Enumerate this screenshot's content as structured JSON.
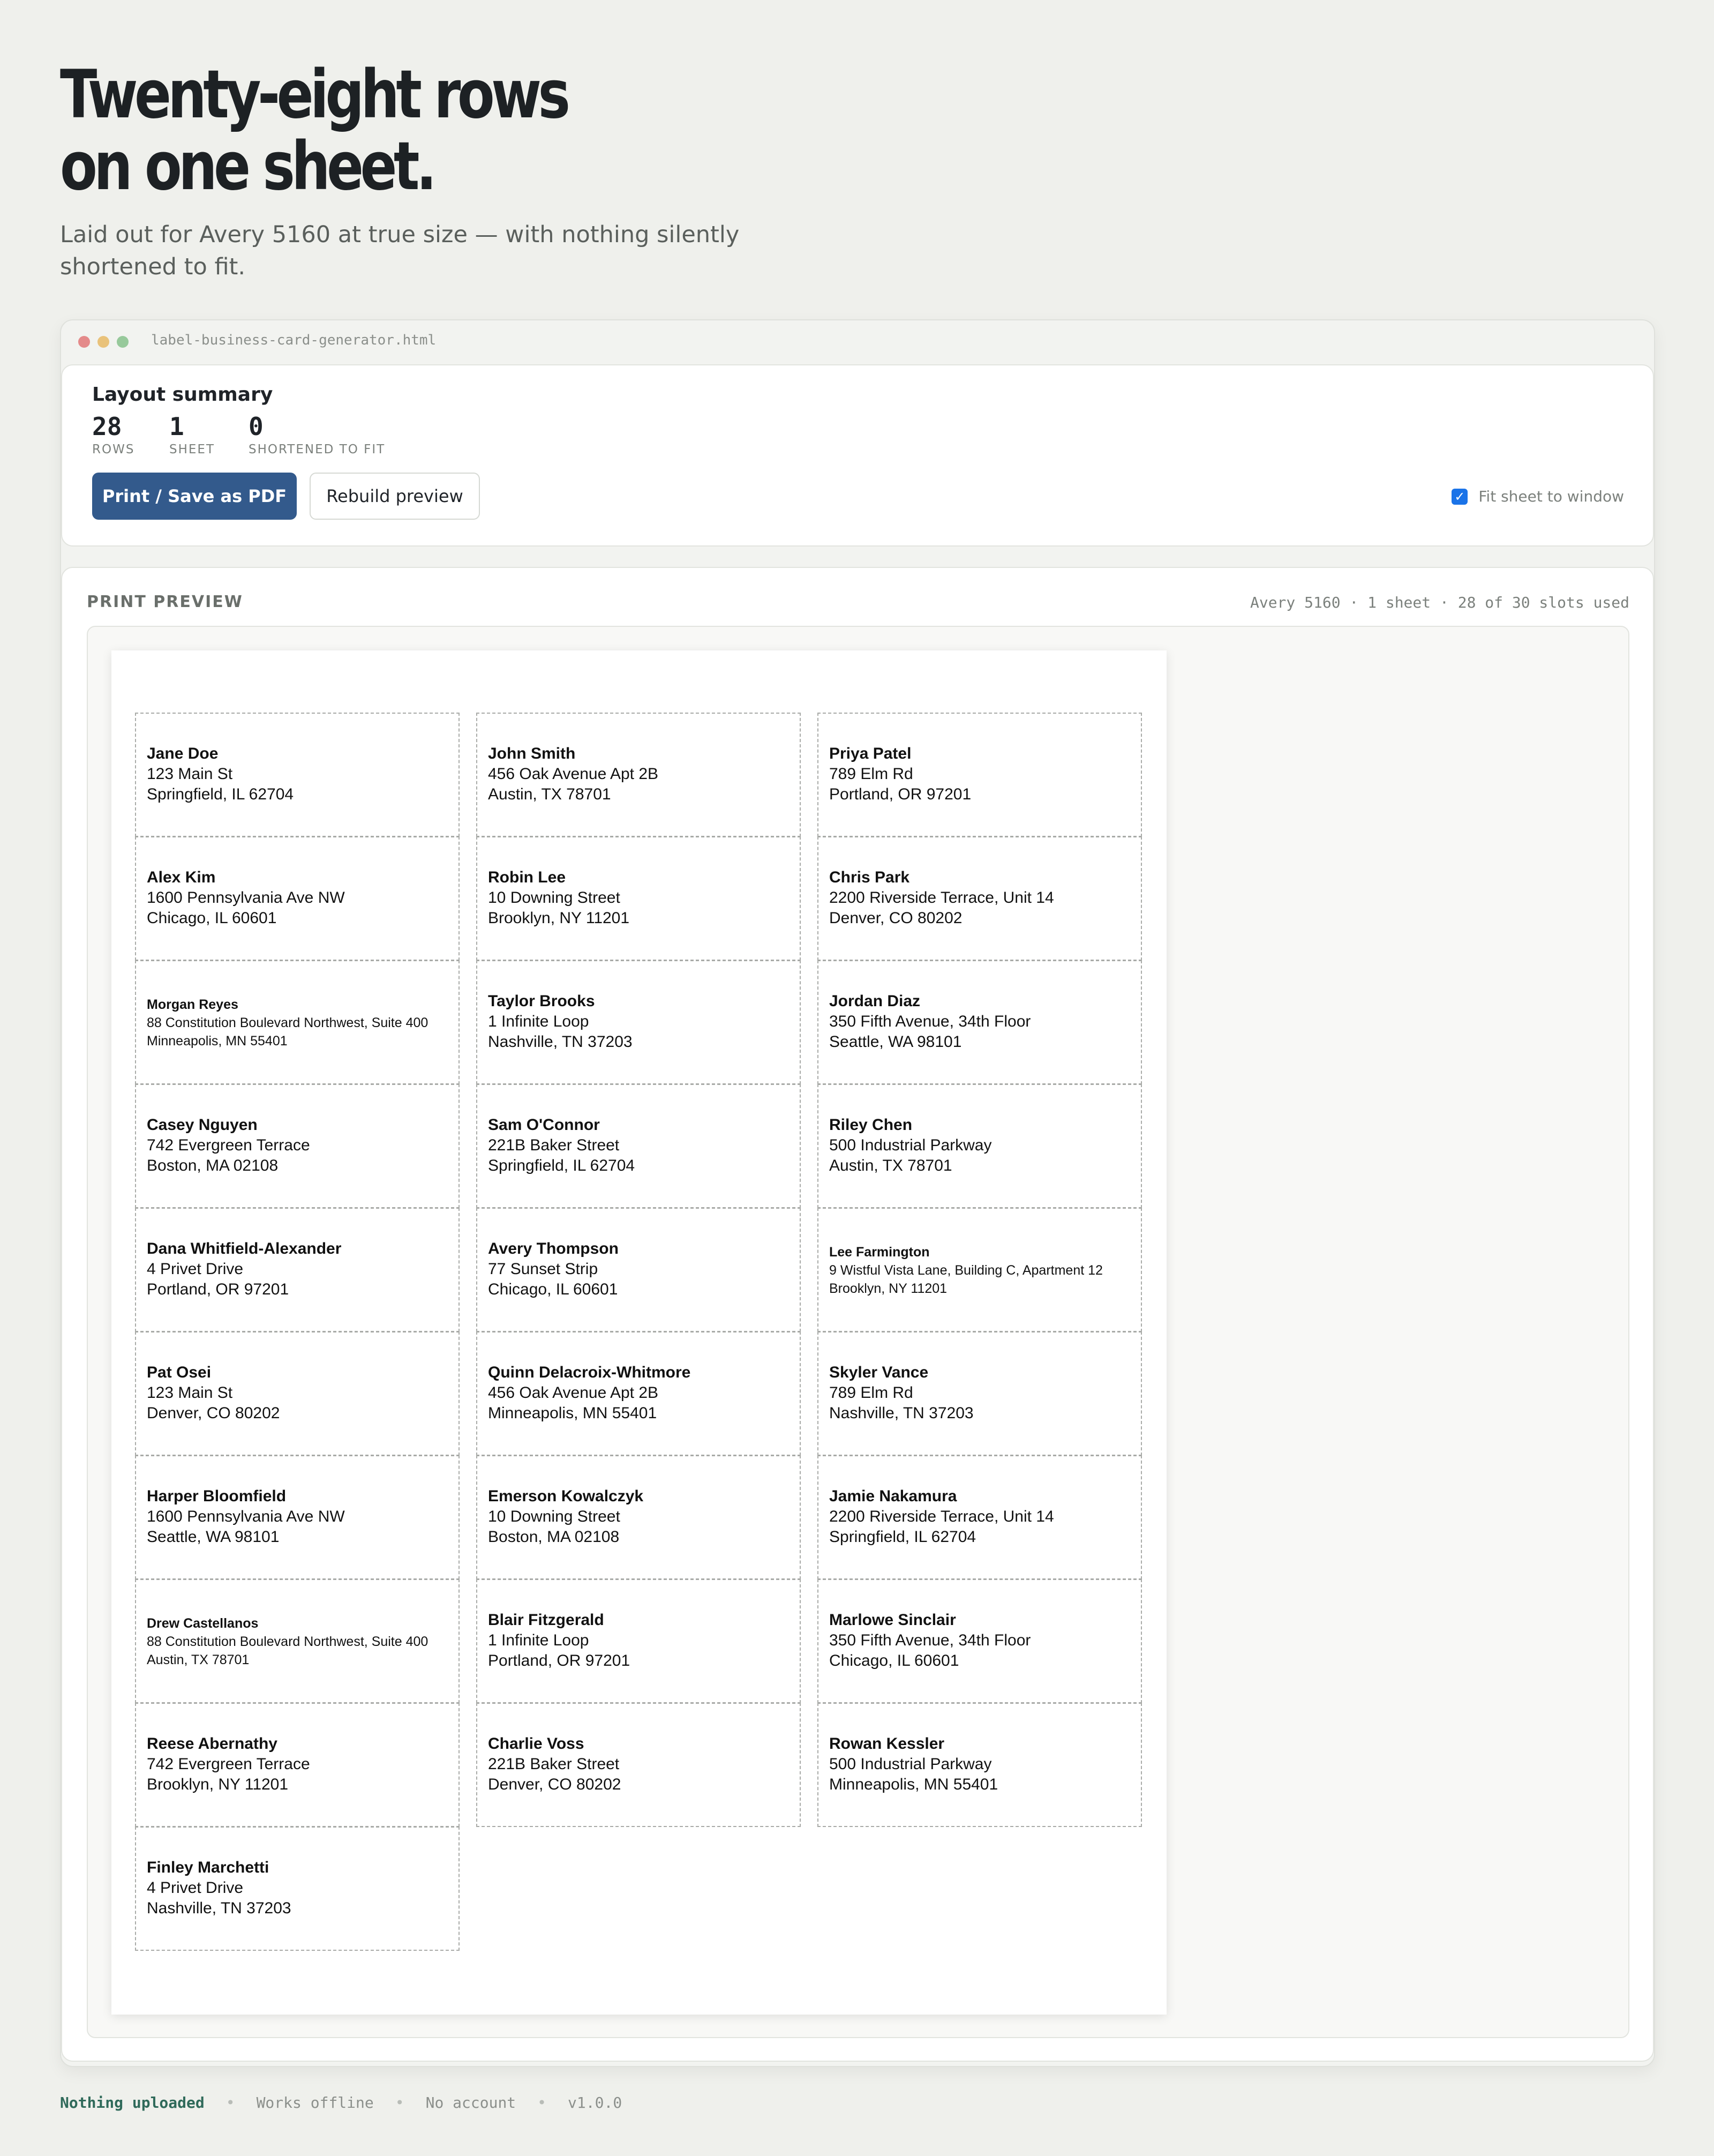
{
  "hero": {
    "title_line1": "Twenty-eight rows",
    "title_line2": "on one sheet.",
    "subtitle": "Laid out for Avery 5160 at true size — with nothing silently shortened to fit."
  },
  "window": {
    "filename": "label-business-card-generator.html"
  },
  "summary": {
    "heading": "Layout summary",
    "stats": [
      {
        "value": "28",
        "label": "ROWS"
      },
      {
        "value": "1",
        "label": "SHEET"
      },
      {
        "value": "0",
        "label": "SHORTENED TO FIT"
      }
    ],
    "print_button": "Print / Save as PDF",
    "rebuild_button": "Rebuild preview",
    "fit_label": "Fit sheet to window",
    "fit_checked": true,
    "accent_color": "#335a8c"
  },
  "preview": {
    "title": "PRINT PREVIEW",
    "info": "Avery 5160 · 1 sheet · 28 of 30 slots used",
    "labels": [
      {
        "name": "Jane Doe",
        "line1": "123 Main St",
        "line2": "Springfield, IL 62704",
        "small": false
      },
      {
        "name": "John Smith",
        "line1": "456 Oak Avenue Apt 2B",
        "line2": "Austin, TX 78701",
        "small": false
      },
      {
        "name": "Priya Patel",
        "line1": "789 Elm Rd",
        "line2": "Portland, OR 97201",
        "small": false
      },
      {
        "name": "Alex Kim",
        "line1": "1600 Pennsylvania Ave NW",
        "line2": "Chicago, IL 60601",
        "small": false
      },
      {
        "name": "Robin Lee",
        "line1": "10 Downing Street",
        "line2": "Brooklyn, NY 11201",
        "small": false
      },
      {
        "name": "Chris Park",
        "line1": "2200 Riverside Terrace, Unit 14",
        "line2": "Denver, CO 80202",
        "small": false
      },
      {
        "name": "Morgan Reyes",
        "line1": "88 Constitution Boulevard Northwest, Suite 400",
        "line2": "Minneapolis, MN 55401",
        "small": true
      },
      {
        "name": "Taylor Brooks",
        "line1": "1 Infinite Loop",
        "line2": "Nashville, TN 37203",
        "small": false
      },
      {
        "name": "Jordan Diaz",
        "line1": "350 Fifth Avenue, 34th Floor",
        "line2": "Seattle, WA 98101",
        "small": false
      },
      {
        "name": "Casey Nguyen",
        "line1": "742 Evergreen Terrace",
        "line2": "Boston, MA 02108",
        "small": false
      },
      {
        "name": "Sam O'Connor",
        "line1": "221B Baker Street",
        "line2": "Springfield, IL 62704",
        "small": false
      },
      {
        "name": "Riley Chen",
        "line1": "500 Industrial Parkway",
        "line2": "Austin, TX 78701",
        "small": false
      },
      {
        "name": "Dana Whitfield-Alexander",
        "line1": "4 Privet Drive",
        "line2": "Portland, OR 97201",
        "small": false
      },
      {
        "name": "Avery Thompson",
        "line1": "77 Sunset Strip",
        "line2": "Chicago, IL 60601",
        "small": false
      },
      {
        "name": "Lee Farmington",
        "line1": "9 Wistful Vista Lane, Building C, Apartment 12",
        "line2": "Brooklyn, NY 11201",
        "small": true
      },
      {
        "name": "Pat Osei",
        "line1": "123 Main St",
        "line2": "Denver, CO 80202",
        "small": false
      },
      {
        "name": "Quinn Delacroix-Whitmore",
        "line1": "456 Oak Avenue Apt 2B",
        "line2": "Minneapolis, MN 55401",
        "small": false
      },
      {
        "name": "Skyler Vance",
        "line1": "789 Elm Rd",
        "line2": "Nashville, TN 37203",
        "small": false
      },
      {
        "name": "Harper Bloomfield",
        "line1": "1600 Pennsylvania Ave NW",
        "line2": "Seattle, WA 98101",
        "small": false
      },
      {
        "name": "Emerson Kowalczyk",
        "line1": "10 Downing Street",
        "line2": "Boston, MA 02108",
        "small": false
      },
      {
        "name": "Jamie Nakamura",
        "line1": "2200 Riverside Terrace, Unit 14",
        "line2": "Springfield, IL 62704",
        "small": false
      },
      {
        "name": "Drew Castellanos",
        "line1": "88 Constitution Boulevard Northwest, Suite 400",
        "line2": "Austin, TX 78701",
        "small": true
      },
      {
        "name": "Blair Fitzgerald",
        "line1": "1 Infinite Loop",
        "line2": "Portland, OR 97201",
        "small": false
      },
      {
        "name": "Marlowe Sinclair",
        "line1": "350 Fifth Avenue, 34th Floor",
        "line2": "Chicago, IL 60601",
        "small": false
      },
      {
        "name": "Reese Abernathy",
        "line1": "742 Evergreen Terrace",
        "line2": "Brooklyn, NY 11201",
        "small": false
      },
      {
        "name": "Charlie Voss",
        "line1": "221B Baker Street",
        "line2": "Denver, CO 80202",
        "small": false
      },
      {
        "name": "Rowan Kessler",
        "line1": "500 Industrial Parkway",
        "line2": "Minneapolis, MN 55401",
        "small": false
      },
      {
        "name": "Finley Marchetti",
        "line1": "4 Privet Drive",
        "line2": "Nashville, TN 37203",
        "small": false
      }
    ]
  },
  "footer": {
    "items": [
      "Nothing uploaded",
      "Works offline",
      "No account",
      "v1.0.0"
    ]
  }
}
